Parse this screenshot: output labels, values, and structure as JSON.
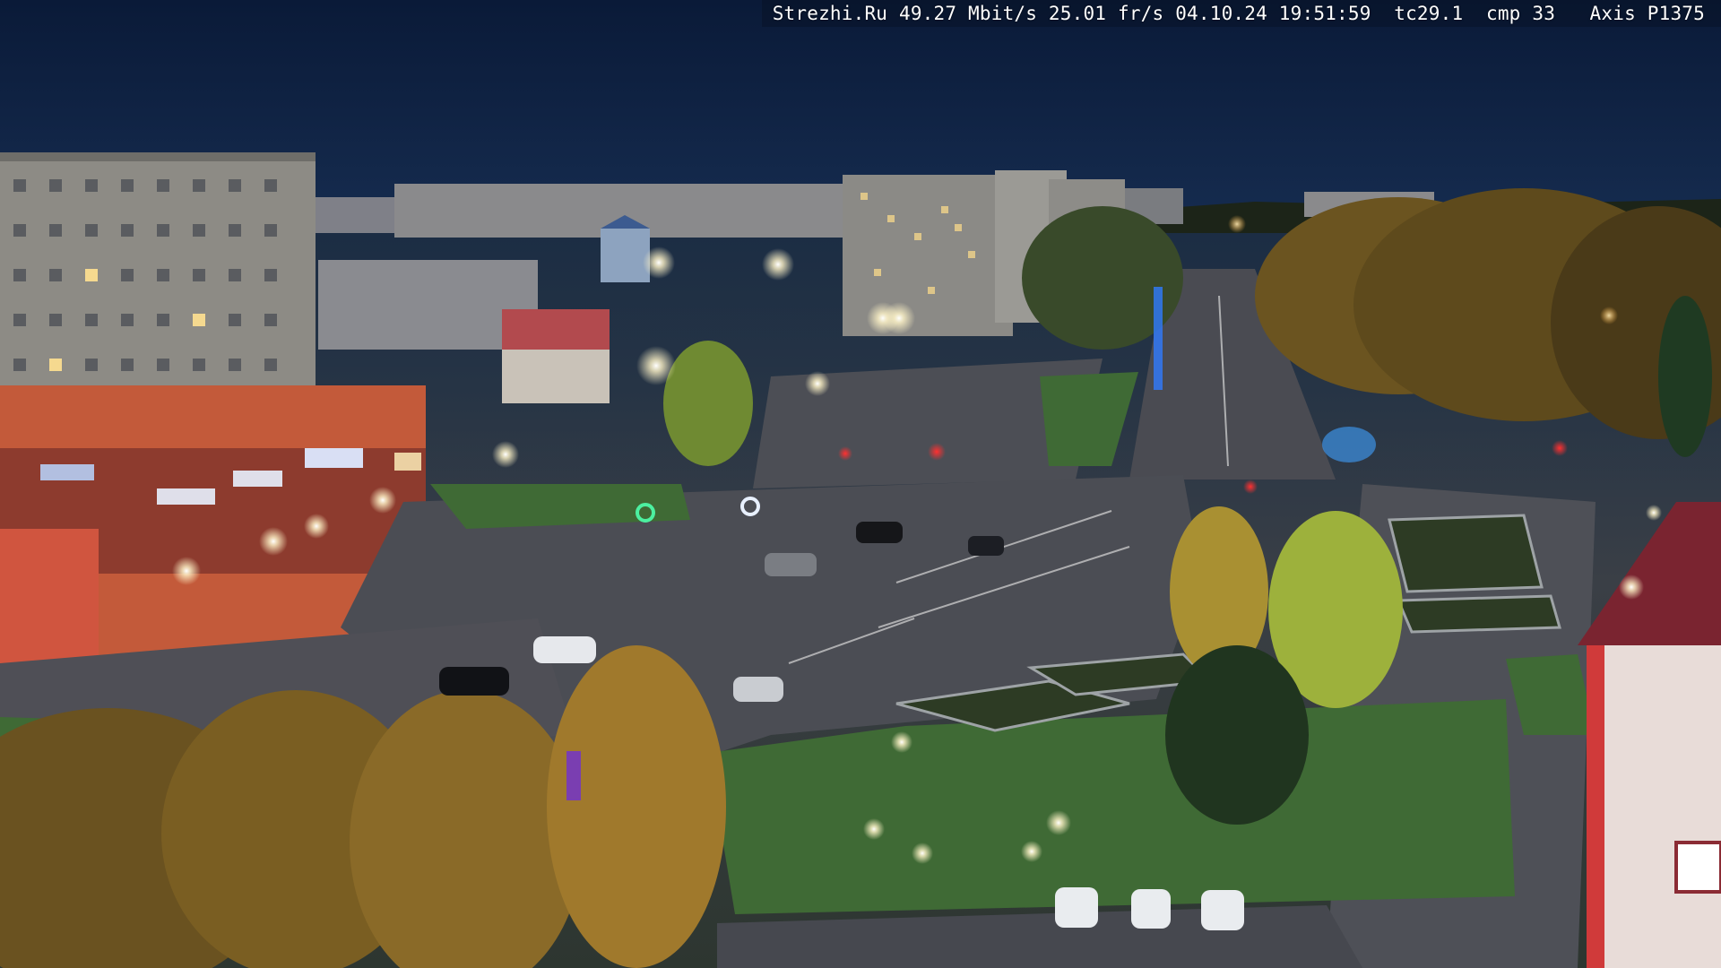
{
  "camera_overlay": {
    "text": "Strezhi.Ru 49.27 Mbit/s 25.01 fr/s 04.10.24 19:51:59  tc29.1  cmp 33   Axis P1375"
  },
  "scene_colors": {
    "sky": "#0c1d3b",
    "asphalt": "#4a4c52",
    "grass": "#3f6a35",
    "autumn_foliage": "#b88a2e",
    "street_light": "#fff6d8",
    "building_panel": "#8d8c86",
    "shop_facade": "#c35a3a"
  }
}
